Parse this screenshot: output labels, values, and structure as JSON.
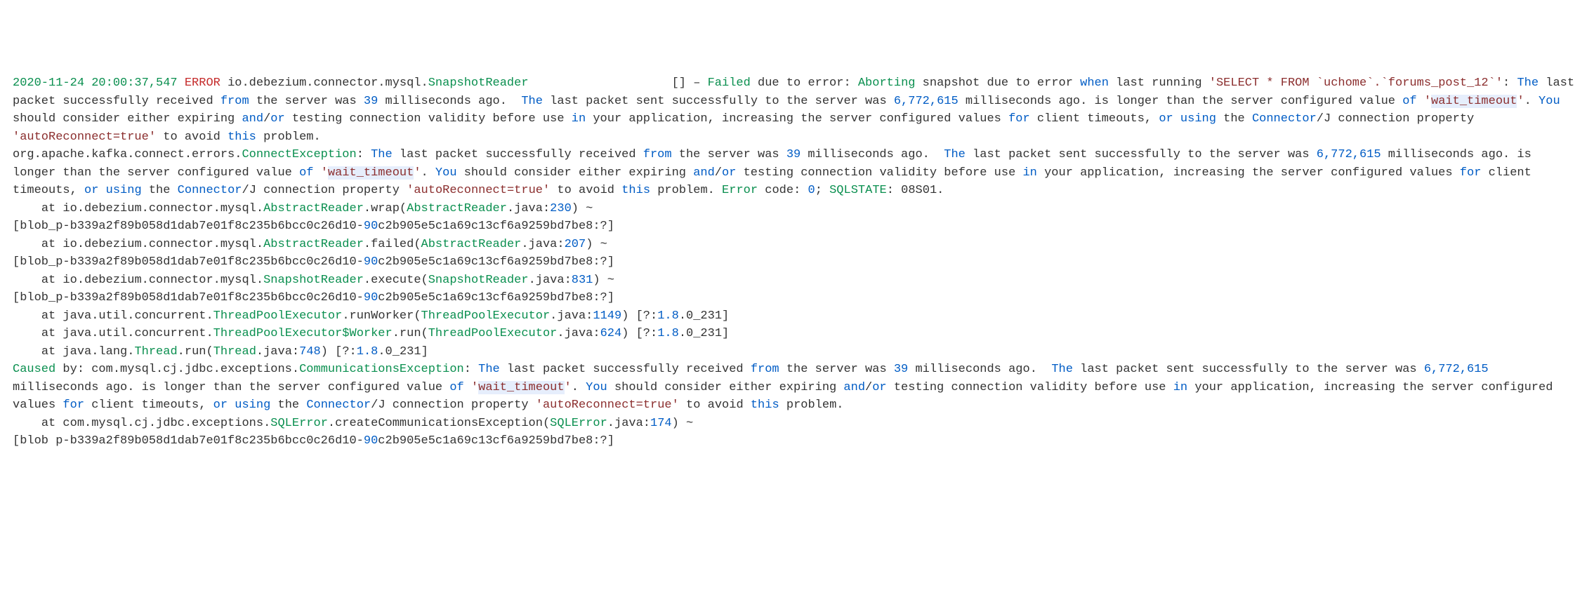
{
  "log": {
    "timestamp": "2020-11-24 20:00:37,547",
    "level": "ERROR",
    "logger_pkg": "io.debezium.connector.mysql.",
    "logger_cls": "SnapshotReader",
    "brackets": "[]",
    "dash": "–",
    "msg_failed": "Failed",
    "msg_due": " due to error:",
    "msg_abort": "Aborting",
    "msg_snap": " snapshot due to error ",
    "kw_when": "when",
    "msg_lastrun": " last running ",
    "sql": "'SELECT * FROM `uchome`.`forums_post_12`'",
    "colon": ": ",
    "kw_the1": "The",
    "packet1a": " last packet successfully received ",
    "kw_from": "from",
    "packet1b": " the server was ",
    "num_39": "39",
    "packet1c": " milliseconds ago.  ",
    "kw_the2": "The",
    "packet2a": " last packet sent successfully to the server was ",
    "num_ms": "6,772,615",
    "packet2b": " milliseconds ago. is longer than the server configured value ",
    "kw_of": "of",
    "sp": " ",
    "wt_q1": "'",
    "wt": "wait_timeout",
    "wt_q2": "'",
    "period": ". ",
    "kw_you": "You",
    "consider": " should consider either expiring ",
    "kw_and": "and",
    "slash": "/",
    "kw_or": "or",
    "testing": " testing connection validity before use ",
    "kw_in": "in",
    "app": " your application, increasing the server configured values ",
    "kw_for": "for",
    "client": " client timeouts, ",
    "kw_or2": "or",
    "using_sp": " ",
    "kw_using": "using",
    "the_sp": " the ",
    "kw_conn": "Connector",
    "conn_j": "/J connection property ",
    "autoR": "'autoReconnect=true'",
    "avoid": " to avoid ",
    "kw_this": "this",
    "problem": " problem.",
    "ex_pkg": "org.apache.kafka.connect.errors.",
    "ex_cls": "ConnectException",
    "err_code": " Error",
    "err_code2": " code: ",
    "num_0": "0",
    "semi": "; ",
    "sqlstate": "SQLSTATE",
    "sqlstate_v": ": 08S01.",
    "at": "    at ",
    "at1_pkg": "io.debezium.connector.mysql.",
    "at1_cls": "AbstractReader",
    "at1_m": ".wrap(",
    "at1_f": "AbstractReader",
    "at1_j": ".java:",
    "at1_n": "230",
    "at1_t": ") ~",
    "blob_a": "[blob_p-b339a2f89b058d1dab7e01f8c235b6bcc0c26d10-",
    "blob_n": "90",
    "blob_b": "c2b905e5c1a69c13cf6a9259bd7be8:?]",
    "at2_m": ".failed(",
    "at2_n": "207",
    "at3_cls": "SnapshotReader",
    "at3_m": ".execute(",
    "at3_f": "SnapshotReader",
    "at3_n": "831",
    "at4_pkg": "java.util.concurrent.",
    "at4_cls": "ThreadPoolExecutor",
    "at4_m": ".runWorker(",
    "at4_f": "ThreadPoolExecutor",
    "at4_n": "1149",
    "at4_t": ") [?:",
    "jv": "1.8",
    "jv2": ".0_231]",
    "at5_cls": "ThreadPoolExecutor$Worker",
    "at5_m": ".run(",
    "at5_n": "624",
    "at6_pkg": "java.lang.",
    "at6_cls": "Thread",
    "at6_m": ".run(",
    "at6_f": "Thread",
    "at6_n": "748",
    "caused": "Caused",
    "caused_by": " by: ",
    "cex_pkg": "com.mysql.cj.jdbc.exceptions.",
    "cex_cls": "CommunicationsException",
    "at7_pkg": "com.mysql.cj.jdbc.exceptions.",
    "at7_cls": "SQLError",
    "at7_m": ".createCommunicationsException(",
    "at7_f": "SQLError",
    "at7_n": "174",
    "blob2_a": "[blob p-b339a2f89b058d1dab7e01f8c235b6bcc0c26d10-"
  }
}
